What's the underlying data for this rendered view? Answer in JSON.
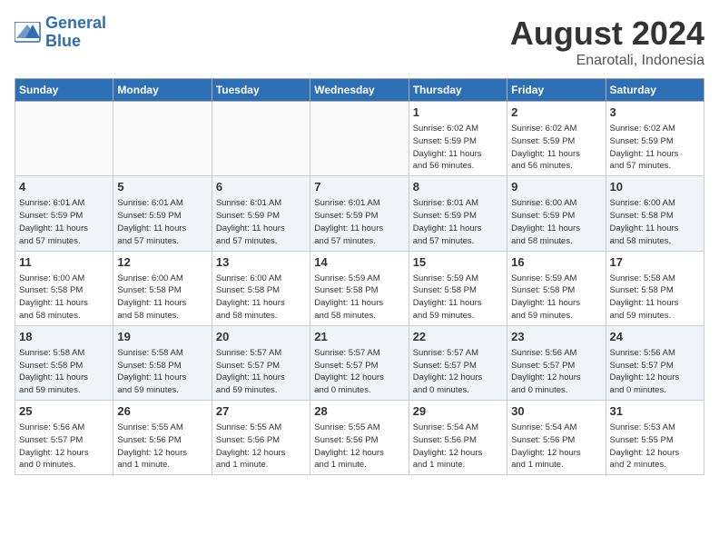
{
  "header": {
    "logo_line1": "General",
    "logo_line2": "Blue",
    "month": "August 2024",
    "location": "Enarotali, Indonesia"
  },
  "days_of_week": [
    "Sunday",
    "Monday",
    "Tuesday",
    "Wednesday",
    "Thursday",
    "Friday",
    "Saturday"
  ],
  "weeks": [
    [
      {
        "day": "",
        "info": ""
      },
      {
        "day": "",
        "info": ""
      },
      {
        "day": "",
        "info": ""
      },
      {
        "day": "",
        "info": ""
      },
      {
        "day": "1",
        "info": "Sunrise: 6:02 AM\nSunset: 5:59 PM\nDaylight: 11 hours\nand 56 minutes."
      },
      {
        "day": "2",
        "info": "Sunrise: 6:02 AM\nSunset: 5:59 PM\nDaylight: 11 hours\nand 56 minutes."
      },
      {
        "day": "3",
        "info": "Sunrise: 6:02 AM\nSunset: 5:59 PM\nDaylight: 11 hours\nand 57 minutes."
      }
    ],
    [
      {
        "day": "4",
        "info": "Sunrise: 6:01 AM\nSunset: 5:59 PM\nDaylight: 11 hours\nand 57 minutes."
      },
      {
        "day": "5",
        "info": "Sunrise: 6:01 AM\nSunset: 5:59 PM\nDaylight: 11 hours\nand 57 minutes."
      },
      {
        "day": "6",
        "info": "Sunrise: 6:01 AM\nSunset: 5:59 PM\nDaylight: 11 hours\nand 57 minutes."
      },
      {
        "day": "7",
        "info": "Sunrise: 6:01 AM\nSunset: 5:59 PM\nDaylight: 11 hours\nand 57 minutes."
      },
      {
        "day": "8",
        "info": "Sunrise: 6:01 AM\nSunset: 5:59 PM\nDaylight: 11 hours\nand 57 minutes."
      },
      {
        "day": "9",
        "info": "Sunrise: 6:00 AM\nSunset: 5:59 PM\nDaylight: 11 hours\nand 58 minutes."
      },
      {
        "day": "10",
        "info": "Sunrise: 6:00 AM\nSunset: 5:58 PM\nDaylight: 11 hours\nand 58 minutes."
      }
    ],
    [
      {
        "day": "11",
        "info": "Sunrise: 6:00 AM\nSunset: 5:58 PM\nDaylight: 11 hours\nand 58 minutes."
      },
      {
        "day": "12",
        "info": "Sunrise: 6:00 AM\nSunset: 5:58 PM\nDaylight: 11 hours\nand 58 minutes."
      },
      {
        "day": "13",
        "info": "Sunrise: 6:00 AM\nSunset: 5:58 PM\nDaylight: 11 hours\nand 58 minutes."
      },
      {
        "day": "14",
        "info": "Sunrise: 5:59 AM\nSunset: 5:58 PM\nDaylight: 11 hours\nand 58 minutes."
      },
      {
        "day": "15",
        "info": "Sunrise: 5:59 AM\nSunset: 5:58 PM\nDaylight: 11 hours\nand 59 minutes."
      },
      {
        "day": "16",
        "info": "Sunrise: 5:59 AM\nSunset: 5:58 PM\nDaylight: 11 hours\nand 59 minutes."
      },
      {
        "day": "17",
        "info": "Sunrise: 5:58 AM\nSunset: 5:58 PM\nDaylight: 11 hours\nand 59 minutes."
      }
    ],
    [
      {
        "day": "18",
        "info": "Sunrise: 5:58 AM\nSunset: 5:58 PM\nDaylight: 11 hours\nand 59 minutes."
      },
      {
        "day": "19",
        "info": "Sunrise: 5:58 AM\nSunset: 5:58 PM\nDaylight: 11 hours\nand 59 minutes."
      },
      {
        "day": "20",
        "info": "Sunrise: 5:57 AM\nSunset: 5:57 PM\nDaylight: 11 hours\nand 59 minutes."
      },
      {
        "day": "21",
        "info": "Sunrise: 5:57 AM\nSunset: 5:57 PM\nDaylight: 12 hours\nand 0 minutes."
      },
      {
        "day": "22",
        "info": "Sunrise: 5:57 AM\nSunset: 5:57 PM\nDaylight: 12 hours\nand 0 minutes."
      },
      {
        "day": "23",
        "info": "Sunrise: 5:56 AM\nSunset: 5:57 PM\nDaylight: 12 hours\nand 0 minutes."
      },
      {
        "day": "24",
        "info": "Sunrise: 5:56 AM\nSunset: 5:57 PM\nDaylight: 12 hours\nand 0 minutes."
      }
    ],
    [
      {
        "day": "25",
        "info": "Sunrise: 5:56 AM\nSunset: 5:57 PM\nDaylight: 12 hours\nand 0 minutes."
      },
      {
        "day": "26",
        "info": "Sunrise: 5:55 AM\nSunset: 5:56 PM\nDaylight: 12 hours\nand 1 minute."
      },
      {
        "day": "27",
        "info": "Sunrise: 5:55 AM\nSunset: 5:56 PM\nDaylight: 12 hours\nand 1 minute."
      },
      {
        "day": "28",
        "info": "Sunrise: 5:55 AM\nSunset: 5:56 PM\nDaylight: 12 hours\nand 1 minute."
      },
      {
        "day": "29",
        "info": "Sunrise: 5:54 AM\nSunset: 5:56 PM\nDaylight: 12 hours\nand 1 minute."
      },
      {
        "day": "30",
        "info": "Sunrise: 5:54 AM\nSunset: 5:56 PM\nDaylight: 12 hours\nand 1 minute."
      },
      {
        "day": "31",
        "info": "Sunrise: 5:53 AM\nSunset: 5:55 PM\nDaylight: 12 hours\nand 2 minutes."
      }
    ]
  ]
}
